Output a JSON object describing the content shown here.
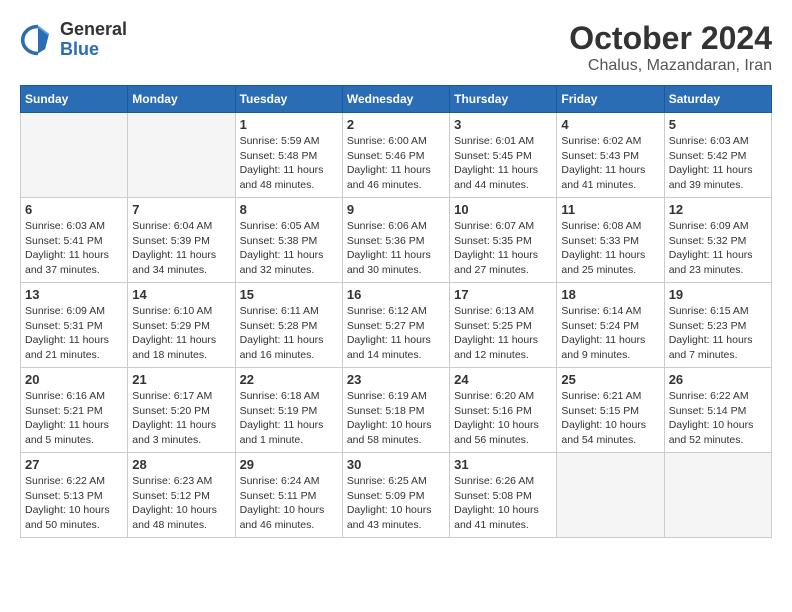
{
  "header": {
    "logo": {
      "general": "General",
      "blue": "Blue"
    },
    "title": "October 2024",
    "subtitle": "Chalus, Mazandaran, Iran"
  },
  "weekdays": [
    "Sunday",
    "Monday",
    "Tuesday",
    "Wednesday",
    "Thursday",
    "Friday",
    "Saturday"
  ],
  "weeks": [
    [
      {
        "day": null,
        "info": null
      },
      {
        "day": null,
        "info": null
      },
      {
        "day": "1",
        "info": "Sunrise: 5:59 AM\nSunset: 5:48 PM\nDaylight: 11 hours and 48 minutes."
      },
      {
        "day": "2",
        "info": "Sunrise: 6:00 AM\nSunset: 5:46 PM\nDaylight: 11 hours and 46 minutes."
      },
      {
        "day": "3",
        "info": "Sunrise: 6:01 AM\nSunset: 5:45 PM\nDaylight: 11 hours and 44 minutes."
      },
      {
        "day": "4",
        "info": "Sunrise: 6:02 AM\nSunset: 5:43 PM\nDaylight: 11 hours and 41 minutes."
      },
      {
        "day": "5",
        "info": "Sunrise: 6:03 AM\nSunset: 5:42 PM\nDaylight: 11 hours and 39 minutes."
      }
    ],
    [
      {
        "day": "6",
        "info": "Sunrise: 6:03 AM\nSunset: 5:41 PM\nDaylight: 11 hours and 37 minutes."
      },
      {
        "day": "7",
        "info": "Sunrise: 6:04 AM\nSunset: 5:39 PM\nDaylight: 11 hours and 34 minutes."
      },
      {
        "day": "8",
        "info": "Sunrise: 6:05 AM\nSunset: 5:38 PM\nDaylight: 11 hours and 32 minutes."
      },
      {
        "day": "9",
        "info": "Sunrise: 6:06 AM\nSunset: 5:36 PM\nDaylight: 11 hours and 30 minutes."
      },
      {
        "day": "10",
        "info": "Sunrise: 6:07 AM\nSunset: 5:35 PM\nDaylight: 11 hours and 27 minutes."
      },
      {
        "day": "11",
        "info": "Sunrise: 6:08 AM\nSunset: 5:33 PM\nDaylight: 11 hours and 25 minutes."
      },
      {
        "day": "12",
        "info": "Sunrise: 6:09 AM\nSunset: 5:32 PM\nDaylight: 11 hours and 23 minutes."
      }
    ],
    [
      {
        "day": "13",
        "info": "Sunrise: 6:09 AM\nSunset: 5:31 PM\nDaylight: 11 hours and 21 minutes."
      },
      {
        "day": "14",
        "info": "Sunrise: 6:10 AM\nSunset: 5:29 PM\nDaylight: 11 hours and 18 minutes."
      },
      {
        "day": "15",
        "info": "Sunrise: 6:11 AM\nSunset: 5:28 PM\nDaylight: 11 hours and 16 minutes."
      },
      {
        "day": "16",
        "info": "Sunrise: 6:12 AM\nSunset: 5:27 PM\nDaylight: 11 hours and 14 minutes."
      },
      {
        "day": "17",
        "info": "Sunrise: 6:13 AM\nSunset: 5:25 PM\nDaylight: 11 hours and 12 minutes."
      },
      {
        "day": "18",
        "info": "Sunrise: 6:14 AM\nSunset: 5:24 PM\nDaylight: 11 hours and 9 minutes."
      },
      {
        "day": "19",
        "info": "Sunrise: 6:15 AM\nSunset: 5:23 PM\nDaylight: 11 hours and 7 minutes."
      }
    ],
    [
      {
        "day": "20",
        "info": "Sunrise: 6:16 AM\nSunset: 5:21 PM\nDaylight: 11 hours and 5 minutes."
      },
      {
        "day": "21",
        "info": "Sunrise: 6:17 AM\nSunset: 5:20 PM\nDaylight: 11 hours and 3 minutes."
      },
      {
        "day": "22",
        "info": "Sunrise: 6:18 AM\nSunset: 5:19 PM\nDaylight: 11 hours and 1 minute."
      },
      {
        "day": "23",
        "info": "Sunrise: 6:19 AM\nSunset: 5:18 PM\nDaylight: 10 hours and 58 minutes."
      },
      {
        "day": "24",
        "info": "Sunrise: 6:20 AM\nSunset: 5:16 PM\nDaylight: 10 hours and 56 minutes."
      },
      {
        "day": "25",
        "info": "Sunrise: 6:21 AM\nSunset: 5:15 PM\nDaylight: 10 hours and 54 minutes."
      },
      {
        "day": "26",
        "info": "Sunrise: 6:22 AM\nSunset: 5:14 PM\nDaylight: 10 hours and 52 minutes."
      }
    ],
    [
      {
        "day": "27",
        "info": "Sunrise: 6:22 AM\nSunset: 5:13 PM\nDaylight: 10 hours and 50 minutes."
      },
      {
        "day": "28",
        "info": "Sunrise: 6:23 AM\nSunset: 5:12 PM\nDaylight: 10 hours and 48 minutes."
      },
      {
        "day": "29",
        "info": "Sunrise: 6:24 AM\nSunset: 5:11 PM\nDaylight: 10 hours and 46 minutes."
      },
      {
        "day": "30",
        "info": "Sunrise: 6:25 AM\nSunset: 5:09 PM\nDaylight: 10 hours and 43 minutes."
      },
      {
        "day": "31",
        "info": "Sunrise: 6:26 AM\nSunset: 5:08 PM\nDaylight: 10 hours and 41 minutes."
      },
      {
        "day": null,
        "info": null
      },
      {
        "day": null,
        "info": null
      }
    ]
  ]
}
